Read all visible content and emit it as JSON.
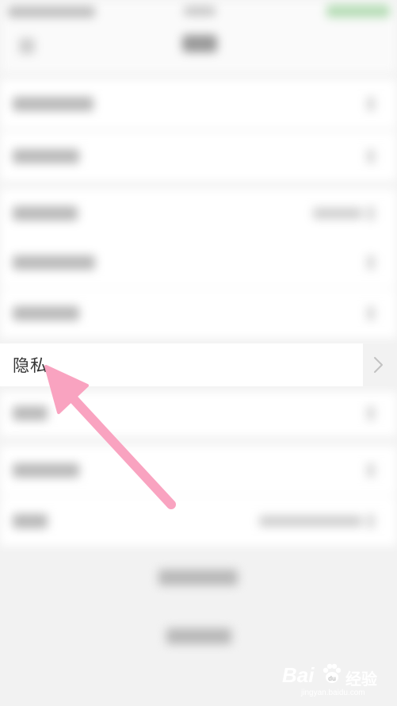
{
  "privacy_row": {
    "label": "隐私"
  },
  "watermark": {
    "brand": "Bai",
    "brand_suffix": "经验",
    "domain": "jingyan.baidu.com"
  },
  "colors": {
    "arrow": "#f9a3c0",
    "page_bg": "#f2f2f2",
    "row_bg": "#ffffff",
    "label": "#333333"
  },
  "icons": {
    "privacy_chevron": "chevron-right-icon",
    "pointer": "arrow-annotation-icon",
    "paw": "baidu-paw-icon"
  }
}
